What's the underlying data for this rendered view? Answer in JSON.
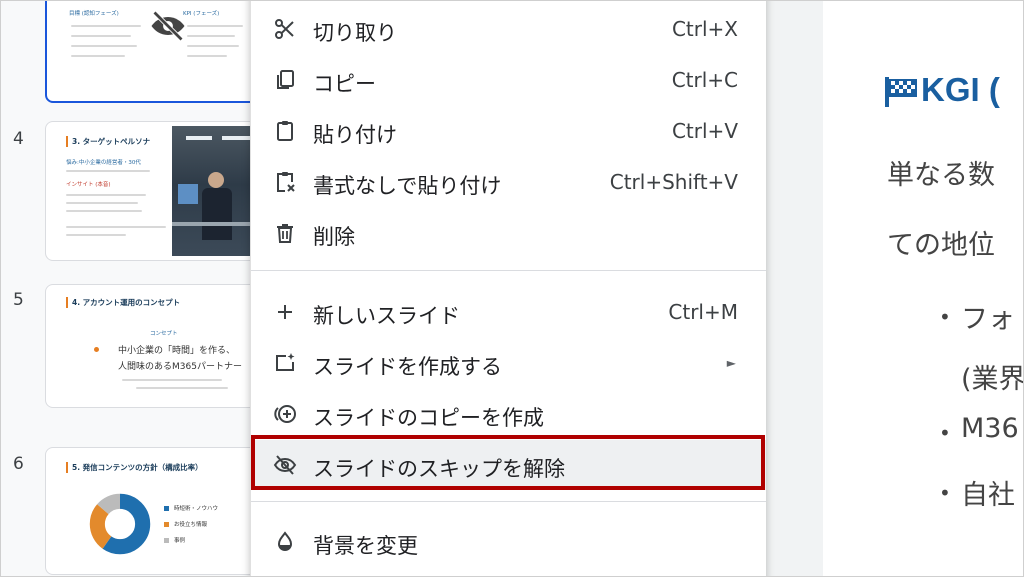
{
  "filmstrip": {
    "slides": [
      {
        "number": "",
        "title": "",
        "text1": "目標 (認知フェーズ)",
        "text2": "KPI (フェーズ)"
      },
      {
        "number": "4",
        "title": "3. ターゲットペルソナ",
        "subtitle": "悩み:中小企業の経営者・30代",
        "insight": "インサイト (本音)",
        "body": "「Officeの使い方が、分からない」"
      },
      {
        "number": "5",
        "title": "4. アカウント運用のコンセプト",
        "concept": "コンセプト",
        "line1": "中小企業の「時間」を作る、",
        "line2": "人間味のあるM365パートナー"
      },
      {
        "number": "6",
        "title": "5. 発信コンテンツの方針（構成比率）",
        "legend": [
          "時短術・ノウハウ",
          "お役立ち情報",
          "事例"
        ]
      }
    ]
  },
  "menu": {
    "items": [
      {
        "label": "切り取り",
        "shortcut": "Ctrl+X",
        "icon": "scissors-icon"
      },
      {
        "label": "コピー",
        "shortcut": "Ctrl+C",
        "icon": "copy-icon"
      },
      {
        "label": "貼り付け",
        "shortcut": "Ctrl+V",
        "icon": "paste-icon"
      },
      {
        "label": "書式なしで貼り付け",
        "shortcut": "Ctrl+Shift+V",
        "icon": "paste-plain-icon"
      },
      {
        "label": "削除",
        "shortcut": "",
        "icon": "trash-icon"
      },
      {
        "label": "新しいスライド",
        "shortcut": "Ctrl+M",
        "icon": "plus-icon"
      },
      {
        "label": "スライドを作成する",
        "shortcut": "",
        "icon": "create-slide-icon",
        "submenu": true
      },
      {
        "label": "スライドのコピーを作成",
        "shortcut": "",
        "icon": "duplicate-icon"
      },
      {
        "label": "スライドのスキップを解除",
        "shortcut": "",
        "icon": "eye-off-icon",
        "highlighted": true
      },
      {
        "label": "背景を変更",
        "shortcut": "",
        "icon": "drop-icon"
      }
    ],
    "submenu_arrow": "►"
  },
  "editor": {
    "heading": "KGI (",
    "line1": "単なる数",
    "line2": "ての地位",
    "bullets": [
      "フォ",
      "(業界",
      "M36",
      "自社"
    ]
  },
  "colors": {
    "highlight_border": "#b00000",
    "selected_thumb": "#1a56db",
    "heading": "#1a5fa0"
  }
}
